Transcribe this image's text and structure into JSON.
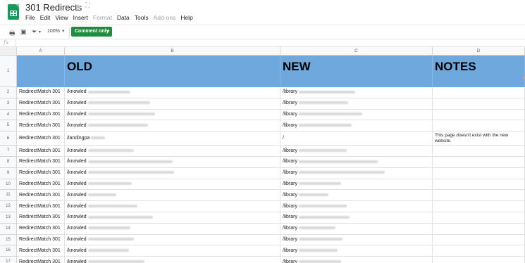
{
  "title": "301 Redirects",
  "icons": {
    "star": "★",
    "drive": "⛶"
  },
  "menu": [
    "File",
    "Edit",
    "View",
    "Insert",
    "Format",
    "Data",
    "Tools",
    "Add-ons",
    "Help"
  ],
  "menu_disabled": [
    "Format",
    "Add-ons"
  ],
  "toolbar": {
    "zoom": "100%",
    "comment_button": "Comment only"
  },
  "formula_label": "fx",
  "columns": [
    "A",
    "B",
    "C",
    "D"
  ],
  "header_row": {
    "number": "1",
    "a": "",
    "b": "OLD",
    "c": "NEW",
    "d": "NOTES"
  },
  "rows": [
    {
      "number": "2",
      "a": "RedirectMatch 301",
      "b": "/knowled",
      "c": "/library",
      "d": ""
    },
    {
      "number": "3",
      "a": "RedirectMatch 301",
      "b": "/knowled",
      "c": "/library",
      "d": ""
    },
    {
      "number": "4",
      "a": "RedirectMatch 301",
      "b": "/knowled",
      "c": "/library",
      "d": ""
    },
    {
      "number": "5",
      "a": "RedirectMatch 301",
      "b": "/knowled",
      "c": "/library",
      "d": ""
    },
    {
      "number": "6",
      "a": "RedirectMatch 301",
      "b": "/landingpa",
      "c": "/",
      "d": "This page doesn't exist with the new website."
    },
    {
      "number": "7",
      "a": "RedirectMatch 301",
      "b": "/knowled",
      "c": "/library",
      "d": ""
    },
    {
      "number": "8",
      "a": "RedirectMatch 301",
      "b": "/knowled",
      "c": "/library",
      "d": ""
    },
    {
      "number": "9",
      "a": "RedirectMatch 301",
      "b": "/knowled",
      "c": "/library",
      "d": ""
    },
    {
      "number": "10",
      "a": "RedirectMatch 301",
      "b": "/knowled",
      "c": "/library",
      "d": ""
    },
    {
      "number": "11",
      "a": "RedirectMatch 301",
      "b": "/knowled",
      "c": "/library",
      "d": ""
    },
    {
      "number": "12",
      "a": "RedirectMatch 301",
      "b": "/knowled",
      "c": "/library",
      "d": ""
    },
    {
      "number": "13",
      "a": "RedirectMatch 301",
      "b": "/knowled",
      "c": "/library",
      "d": ""
    },
    {
      "number": "14",
      "a": "RedirectMatch 301",
      "b": "/knowled",
      "c": "/library",
      "d": ""
    },
    {
      "number": "15",
      "a": "RedirectMatch 301",
      "b": "/knowled",
      "c": "/library",
      "d": ""
    },
    {
      "number": "16",
      "a": "RedirectMatch 301",
      "b": "/knowled",
      "c": "/library",
      "d": ""
    },
    {
      "number": "17",
      "a": "RedirectMatch 301",
      "b": "/knowled",
      "c": "/library",
      "d": ""
    }
  ],
  "colors": {
    "header_fill": "#6fa8dc",
    "comment_button": "#1e8e3e",
    "sheets_icon": "#0f9d58"
  }
}
